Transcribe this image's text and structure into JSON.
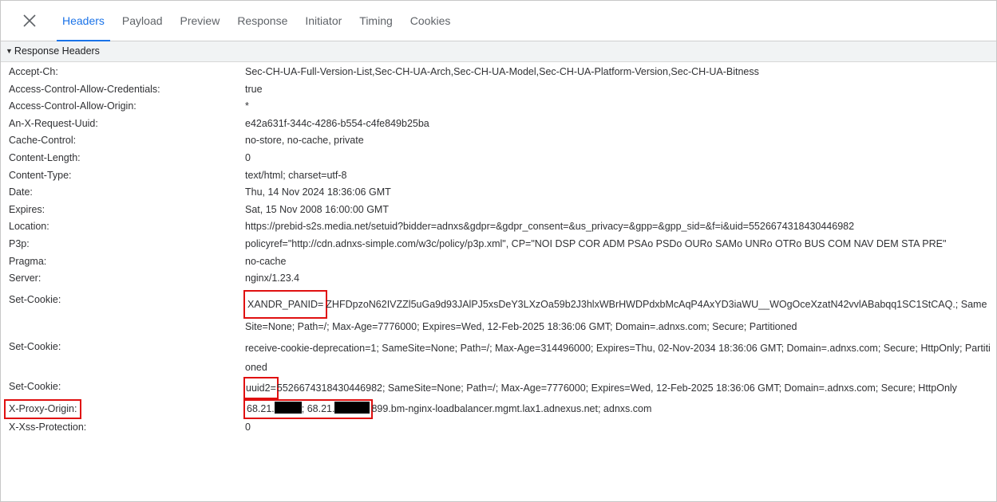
{
  "tabs": [
    {
      "label": "Headers",
      "active": true
    },
    {
      "label": "Payload"
    },
    {
      "label": "Preview"
    },
    {
      "label": "Response"
    },
    {
      "label": "Initiator"
    },
    {
      "label": "Timing"
    },
    {
      "label": "Cookies"
    }
  ],
  "section": {
    "title": "Response Headers"
  },
  "headers": [
    {
      "name": "Accept-Ch:",
      "value": "Sec-CH-UA-Full-Version-List,Sec-CH-UA-Arch,Sec-CH-UA-Model,Sec-CH-UA-Platform-Version,Sec-CH-UA-Bitness"
    },
    {
      "name": "Access-Control-Allow-Credentials:",
      "value": "true"
    },
    {
      "name": "Access-Control-Allow-Origin:",
      "value": "*"
    },
    {
      "name": "An-X-Request-Uuid:",
      "value": "e42a631f-344c-4286-b554-c4fe849b25ba"
    },
    {
      "name": "Cache-Control:",
      "value": "no-store, no-cache, private"
    },
    {
      "name": "Content-Length:",
      "value": "0"
    },
    {
      "name": "Content-Type:",
      "value": "text/html; charset=utf-8"
    },
    {
      "name": "Date:",
      "value": "Thu, 14 Nov 2024 18:36:06 GMT"
    },
    {
      "name": "Expires:",
      "value": "Sat, 15 Nov 2008 16:00:00 GMT"
    },
    {
      "name": "Location:",
      "value": "https://prebid-s2s.media.net/setuid?bidder=adnxs&gdpr=&gdpr_consent=&us_privacy=&gpp=&gpp_sid=&f=i&uid=5526674318430446982"
    },
    {
      "name": "P3p:",
      "value": "policyref=\"http://cdn.adnxs-simple.com/w3c/policy/p3p.xml\", CP=\"NOI DSP COR ADM PSAo PSDo OURo SAMo UNRo OTRo BUS COM NAV DEM STA PRE\""
    },
    {
      "name": "Pragma:",
      "value": "no-cache"
    },
    {
      "name": "Server:",
      "value": "nginx/1.23.4"
    }
  ],
  "set_cookie_1": {
    "name": "Set-Cookie:",
    "key": "XANDR_PANID=",
    "rest": "ZHFDpzoN62IVZZl5uGa9d93JAlPJ5xsDeY3LXzOa59b2J3hlxWBrHWDPdxbMcAqP4AxYD3iaWU__WOgOceXzatN42vvlABabqq1SC1StCAQ.; SameSite=None; Path=/; Max-Age=7776000; Expires=Wed, 12-Feb-2025 18:36:06 GMT; Domain=.adnxs.com; Secure; Partitioned"
  },
  "set_cookie_2": {
    "name": "Set-Cookie:",
    "value": "receive-cookie-deprecation=1; SameSite=None; Path=/; Max-Age=314496000; Expires=Thu, 02-Nov-2034 18:36:06 GMT; Domain=.adnxs.com; Secure; HttpOnly; Partitioned"
  },
  "set_cookie_3": {
    "name": "Set-Cookie:",
    "key": "uuid2=",
    "rest": "5526674318430446982; SameSite=None; Path=/; Max-Age=7776000; Expires=Wed, 12-Feb-2025 18:36:06 GMT; Domain=.adnxs.com; Secure; HttpOnly"
  },
  "proxy": {
    "name": "X-Proxy-Origin:",
    "ip1_prefix": "68.21.",
    "separator": "; 68.21.",
    "suffix": "899.bm-nginx-loadbalancer.mgmt.lax1.adnexus.net; adnxs.com"
  },
  "xss": {
    "name": "X-Xss-Protection:",
    "value": "0"
  },
  "colors": {
    "accent": "#1a73e8",
    "highlight": "#e01010"
  },
  "icons": {
    "close": "close-icon",
    "expand": "triangle-down-icon"
  }
}
